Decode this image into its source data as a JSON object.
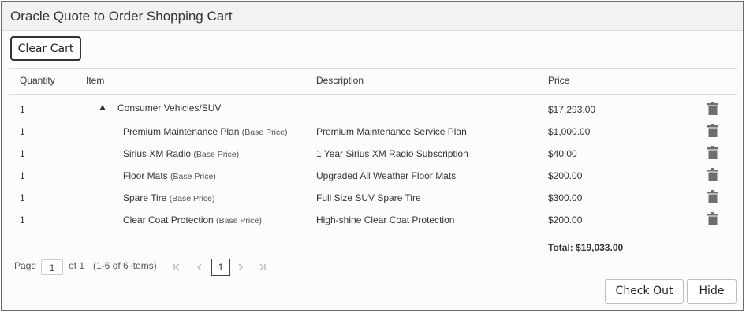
{
  "window": {
    "title": "Oracle Quote to Order Shopping Cart"
  },
  "toolbar": {
    "clear_cart_label": "Clear Cart"
  },
  "table": {
    "headers": [
      "Quantity",
      "Item",
      "Description",
      "Price"
    ],
    "rows": [
      {
        "qty": "1",
        "item": "Consumer Vehicles/SUV",
        "base": "",
        "description": "",
        "price": "$17,293.00"
      },
      {
        "qty": "1",
        "item": "Premium Maintenance Plan",
        "base": "(Base Price)",
        "description": "Premium Maintenance Service Plan",
        "price": "$1,000.00"
      },
      {
        "qty": "1",
        "item": "Sirius XM Radio",
        "base": "(Base Price)",
        "description": "1 Year Sirius XM Radio Subscription",
        "price": "$40.00"
      },
      {
        "qty": "1",
        "item": "Floor Mats",
        "base": "(Base Price)",
        "description": "Upgraded All Weather Floor Mats",
        "price": "$200.00"
      },
      {
        "qty": "1",
        "item": "Spare Tire",
        "base": "(Base Price)",
        "description": "Full Size SUV Spare Tire",
        "price": "$300.00"
      },
      {
        "qty": "1",
        "item": "Clear Coat Protection",
        "base": "(Base Price)",
        "description": "High-shine Clear Coat Protection",
        "price": "$200.00"
      }
    ],
    "total": "Total: $19,033.00"
  },
  "pagination": {
    "page_label": "Page",
    "page_value": "1",
    "of_label": "of 1",
    "items_label": "(1-6 of 6 items)",
    "current_page": "1",
    "first_icon": "first-page-icon",
    "prev_icon": "previous-page-icon",
    "next_icon": "next-page-icon",
    "last_icon": "last-page-icon"
  },
  "actions": {
    "checkout_label": "Check Out",
    "hide_label": "Hide"
  },
  "icons": {
    "row_delete": "trash-icon",
    "expand": "collapse-caret-icon"
  },
  "colors": {
    "border": "#6b6b6b",
    "titlebar": "#f2f2f2",
    "trash": "#6e6e6e"
  }
}
